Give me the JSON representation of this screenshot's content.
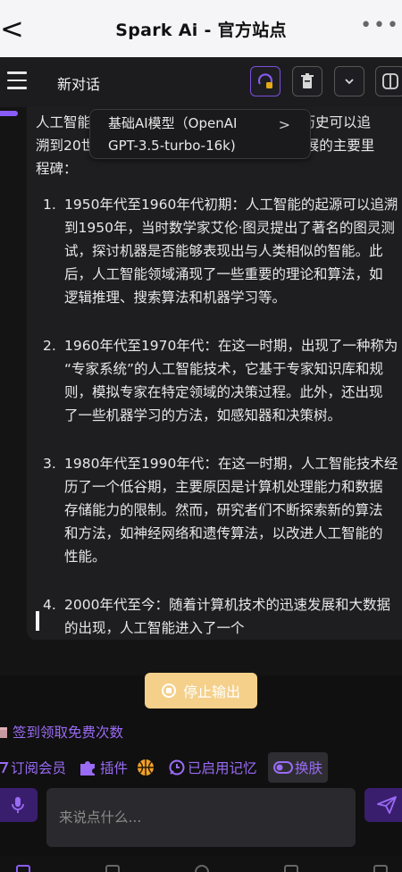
{
  "browser": {
    "title": "Spark Ai - 官方站点",
    "back_glyph": "<",
    "more_glyph": "•••"
  },
  "header": {
    "chat_title": "新对话",
    "icons": [
      "menu-icon",
      "paid-model-icon",
      "delete-icon",
      "chevron-down-icon",
      "toggle-icon"
    ]
  },
  "tooltip": {
    "line1": "基础AI模型（OpenAI",
    "line2": "GPT-3.5-turbo-16k)",
    "chevron": ">"
  },
  "message": {
    "intro_line1": "人工智能",
    "intro_line1_tail": "的历史可以追",
    "intro_line2": "溯到20世",
    "intro_line2_tail": "发展的主要里",
    "intro_line3": "程碑：",
    "items": [
      {
        "num": "1.",
        "lines": [
          "1950年代至1960年代初期：人工智能的起源可以追溯",
          "到1950年，当时数学家艾伦·图灵提出了著名的图灵测",
          "试，探讨机器是否能够表现出与人类相似的智能。此",
          "后，人工智能领域涌现了一些重要的理论和算法，如",
          "逻辑推理、搜索算法和机器学习等。"
        ]
      },
      {
        "num": "2.",
        "lines": [
          "1960年代至1970年代：在这一时期，出现了一种称为",
          "“专家系统”的人工智能技术，它基于专家知识库和规",
          "则，模拟专家在特定领域的决策过程。此外，还出现",
          "了一些机器学习的方法，如感知器和决策树。"
        ]
      },
      {
        "num": "3.",
        "lines": [
          "1980年代至1990年代：在这一时期，人工智能技术经",
          "历了一个低谷期，主要原因是计算机处理能力和数据",
          "存储能力的限制。然而，研究者们不断探索新的算法",
          "和方法，如神经网络和遗传算法，以改进人工智能的",
          "性能。"
        ]
      },
      {
        "num": "4.",
        "lines": [
          "2000年代至今：随着计算机技术的迅速发展和大数据",
          "的出现，人工智能进入了一个"
        ]
      }
    ]
  },
  "controls": {
    "stop_label": "停止输出",
    "signin_label": "签到领取免费次数",
    "subscribe_label": "订阅会员",
    "plugins_label": "插件",
    "memory_label": "已启用记忆",
    "skin_label": "换肤",
    "input_placeholder": "来说点什么..."
  },
  "colors": {
    "accent_purple": "#9a6bf5",
    "stop_button": "#f5d08a",
    "background": "#141414"
  }
}
